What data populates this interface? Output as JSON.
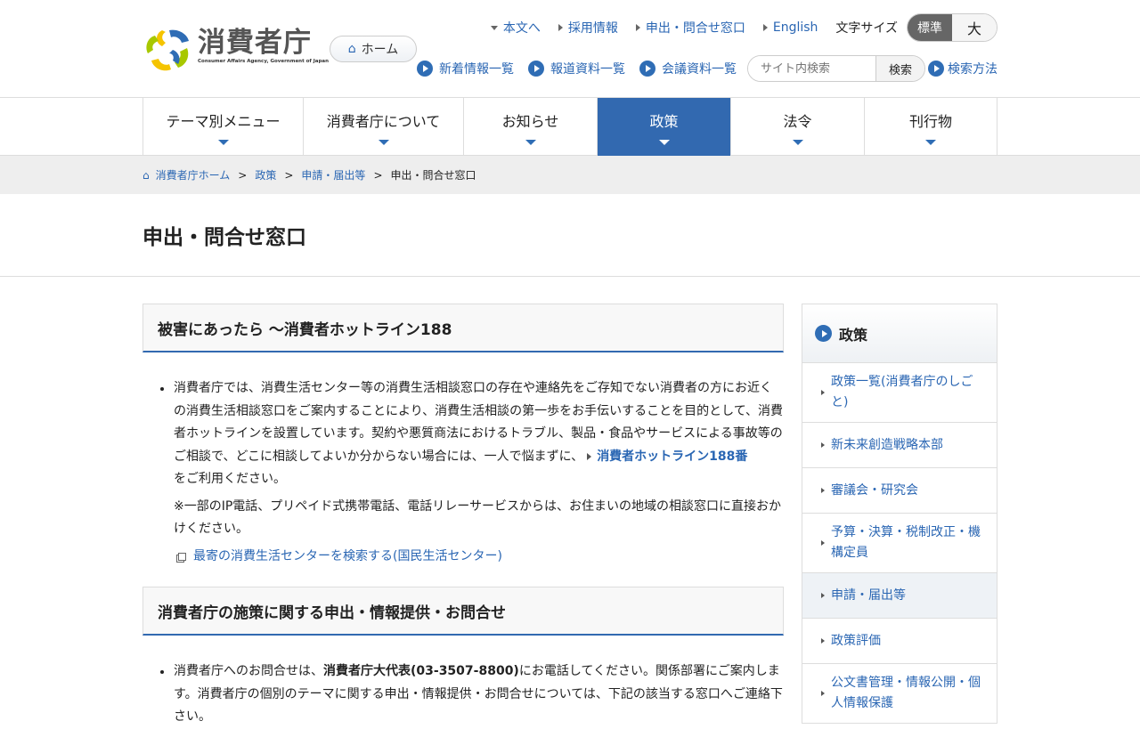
{
  "header": {
    "logo_text": "消費者庁",
    "logo_subtext": "Consumer Affairs Agency, Government of Japan",
    "home_label": "ホーム",
    "top_links": [
      {
        "label": "本文へ"
      },
      {
        "label": "採用情報"
      },
      {
        "label": "申出・問合せ窓口"
      },
      {
        "label": "English"
      }
    ],
    "font_size_label": "文字サイズ",
    "font_size_options": [
      "標準",
      "大"
    ],
    "font_size_selected": "標準",
    "quick_links": [
      {
        "label": "新着情報一覧"
      },
      {
        "label": "報道資料一覧"
      },
      {
        "label": "会議資料一覧"
      }
    ],
    "search_placeholder": "サイト内検索",
    "search_button": "検索",
    "search_help": "検索方法"
  },
  "nav": [
    {
      "label": "テーマ別メニュー"
    },
    {
      "label": "消費者庁について"
    },
    {
      "label": "お知らせ"
    },
    {
      "label": "政策",
      "active": true
    },
    {
      "label": "法令"
    },
    {
      "label": "刊行物"
    }
  ],
  "breadcrumb": {
    "items": [
      "消費者庁ホーム",
      "政策",
      "申請・届出等"
    ],
    "current": "申出・問合せ窓口",
    "separator": ">"
  },
  "page_title": "申出・問合せ窓口",
  "sections": [
    {
      "heading": "被害にあったら ～消費者ホットライン188",
      "text_before": "消費者庁では、消費生活センター等の消費生活相談窓口の存在や連絡先をご存知でない消費者の方にお近くの消費生活相談窓口をご案内することにより、消費生活相談の第一歩をお手伝いすることを目的として、消費者ホットラインを設置しています。契約や悪質商法におけるトラブル、製品・食品やサービスによる事故等のご相談で、どこに相談してよいか分からない場合には、一人で悩まずに、",
      "link": "消費者ホットライン188番",
      "text_after": "をご利用ください。",
      "note": "※一部のIP電話、プリペイド式携帯電話、電話リレーサービスからは、お住まいの地域の相談窓口に直接おかけください。",
      "external_link": "最寄の消費生活センターを検索する(国民生活センター)"
    },
    {
      "heading": "消費者庁の施策に関する申出・情報提供・お問合せ",
      "text_before": "消費者庁へのお問合せは、",
      "bold": "消費者庁大代表(03-3507-8800)",
      "text_after": "にお電話してください。関係部署にご案内します。消費者庁の個別のテーマに関する申出・情報提供・お問合せについては、下記の該当する窓口へご連絡下さい。"
    }
  ],
  "sidebar": {
    "heading": "政策",
    "items": [
      {
        "label": "政策一覧(消費者庁のしごと)"
      },
      {
        "label": "新未来創造戦略本部"
      },
      {
        "label": "審議会・研究会"
      },
      {
        "label": "予算・決算・税制改正・機構定員"
      },
      {
        "label": "申請・届出等",
        "current": true
      },
      {
        "label": "政策評価"
      },
      {
        "label": "公文書管理・情報公開・個人情報保護"
      }
    ]
  }
}
